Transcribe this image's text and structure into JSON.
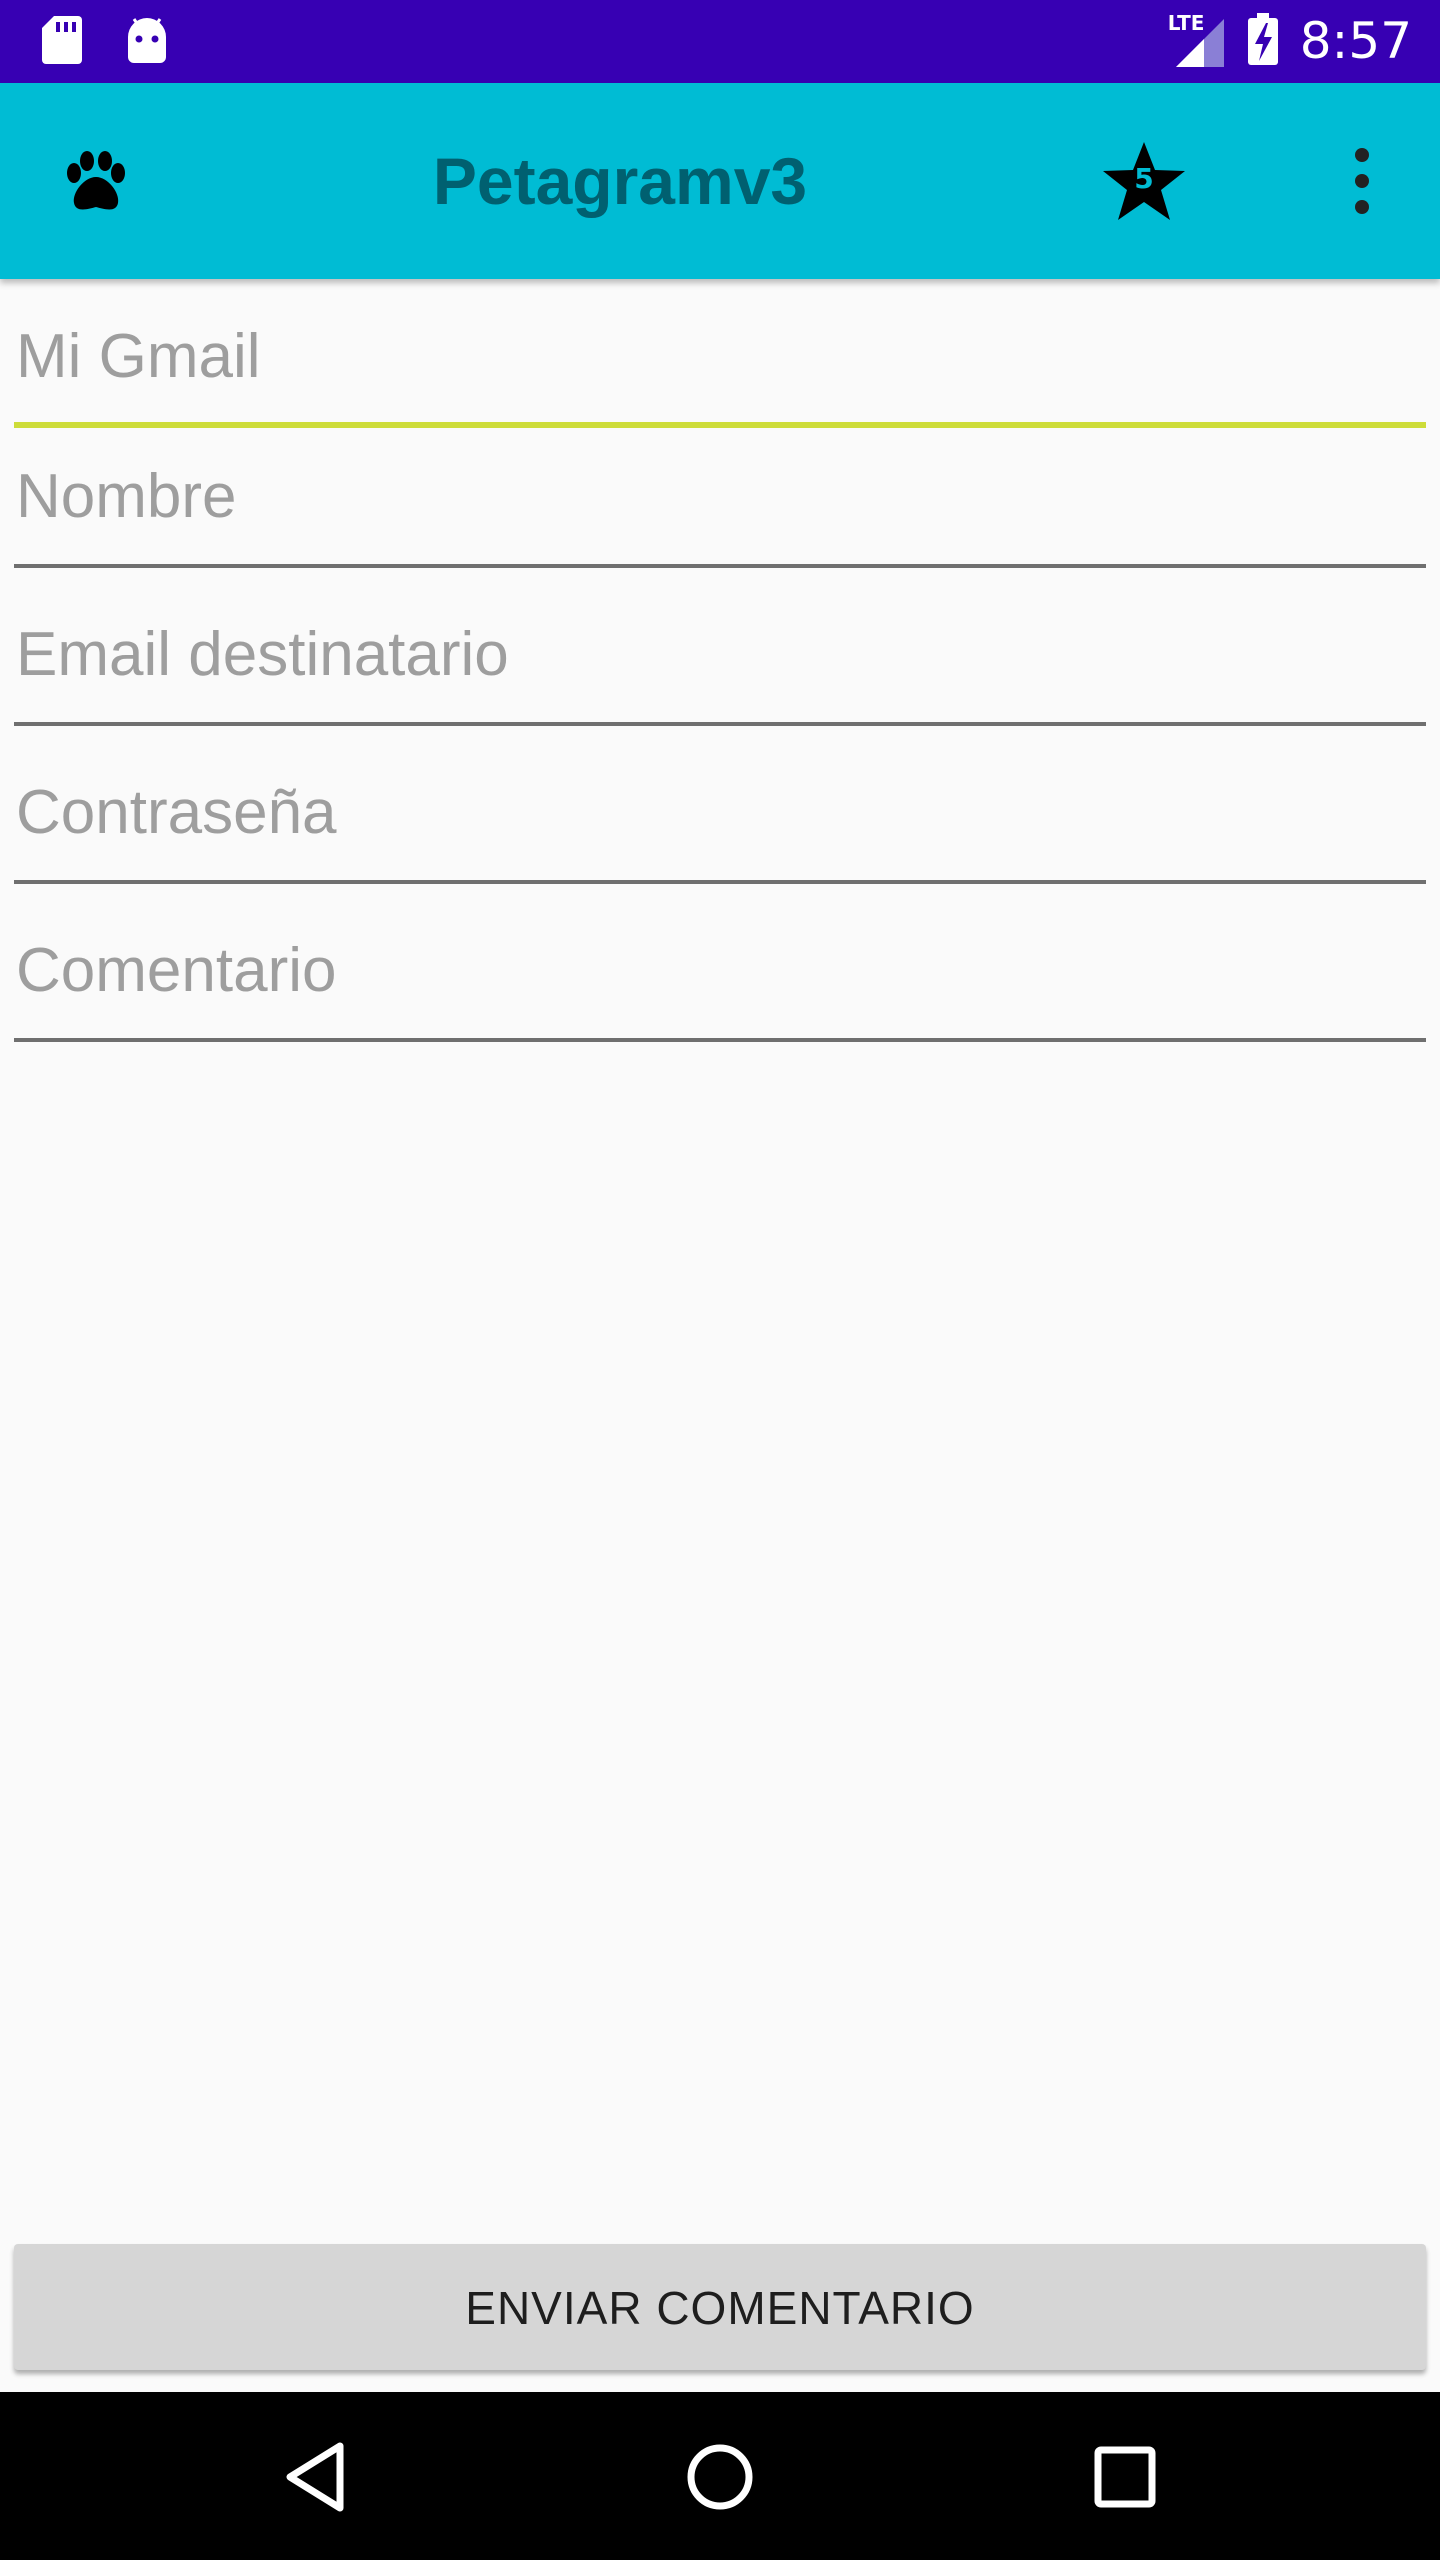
{
  "status_bar": {
    "time": "8:57",
    "network": "LTE",
    "icons": [
      "sd-card-icon",
      "android-icon",
      "signal-icon",
      "battery-charging-icon"
    ]
  },
  "app_bar": {
    "title": "Petagramv3",
    "left_icon": "paw-icon",
    "favorites_count": "5",
    "favorites_icon": "star-icon",
    "overflow_icon": "more-vert-icon"
  },
  "form": {
    "fields": [
      {
        "placeholder": "Mi Gmail",
        "value": ""
      },
      {
        "placeholder": "Nombre",
        "value": ""
      },
      {
        "placeholder": "Email destinatario",
        "value": ""
      },
      {
        "placeholder": "Contraseña",
        "value": ""
      },
      {
        "placeholder": "Comentario",
        "value": ""
      }
    ],
    "submit_label": "ENVIAR COMENTARIO"
  },
  "nav_bar": {
    "buttons": [
      "back-icon",
      "home-icon",
      "recents-icon"
    ]
  },
  "colors": {
    "status_bar": "#3700b3",
    "app_bar": "#00bcd4",
    "title_text": "#006070",
    "focus_underline": "#cddc39",
    "underline": "#6f6f6f",
    "button": "#d6d6d6",
    "background": "#fafafa"
  }
}
